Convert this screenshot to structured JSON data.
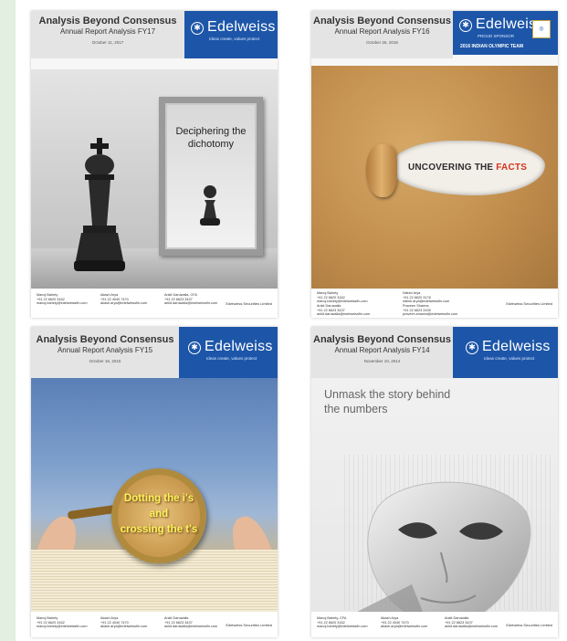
{
  "covers": [
    {
      "title": "Analysis Beyond Consensus",
      "subtitle": "Annual Report Analysis FY17",
      "date": "October 11, 2017",
      "brand": "Edelweiss",
      "tagline": "Ideas create, values protect",
      "headline": "Deciphering the dichotomy",
      "footer": [
        [
          "Manoj Bahety",
          "+91 22 6620 3162",
          "manoj.bahety@edelweissfin.com"
        ],
        [
          "Akash Arya",
          "+91 22 4040 7470",
          "akash.arya@edelweissfin.com"
        ],
        [
          "Ankit Daruwalla, CFA",
          "+91 22 6623 3437",
          "ankit.daruwalla@edelweissfin.com"
        ]
      ],
      "footer_right": "Edelweiss Securities Limited"
    },
    {
      "title": "Analysis Beyond Consensus",
      "subtitle": "Annual Report Analysis FY16",
      "date": "October 26, 2016",
      "brand": "Edelweiss",
      "tagline": "PROUD SPONSOR",
      "sponsor": "2016 INDIAN OLYMPIC TEAM",
      "headline_a": "UNCOVERING THE ",
      "headline_b": "FACTS",
      "footer": [
        [
          "Manoj Bahety",
          "+91 22 6620 3162",
          "manoj.bahety@edelweissfin.com"
        ],
        [
          "Nitesh Arya",
          "+91 22 6620 3178",
          "nitesh.arya@edelweissfin.com"
        ],
        [
          "Ankit Daruwalla",
          "+91 22 6623 3437",
          "ankit.daruwalla@edelweissfin.com"
        ],
        [
          "Praveen Sharma",
          "+91 22 6623 3155",
          "praveen.sharma@edelweissfin.com"
        ]
      ],
      "footer_right": "Edelweiss Securities Limited"
    },
    {
      "title": "Analysis Beyond Consensus",
      "subtitle": "Annual Report Analysis FY15",
      "date": "October 16, 2015",
      "brand": "Edelweiss",
      "tagline": "Ideas create, values protect",
      "headline_lines": [
        "Dotting the i's",
        "and",
        "crossing the t's"
      ],
      "footer": [
        [
          "Manoj Bahety",
          "+91 22 6620 3162",
          "manoj.bahety@edelweissfin.com"
        ],
        [
          "Akash Arya",
          "+91 22 4040 7470",
          "akash.arya@edelweissfin.com"
        ],
        [
          "Ankit Daruwalla",
          "+91 22 6623 3437",
          "ankit.daruwalla@edelweissfin.com"
        ]
      ],
      "footer_right": "Edelweiss Securities Limited"
    },
    {
      "title": "Analysis Beyond Consensus",
      "subtitle": "Annual Report Analysis FY14",
      "date": "November 10, 2014",
      "brand": "Edelweiss",
      "tagline": "Ideas create, values protect",
      "headline_lines": [
        "Unmask the story behind",
        "the numbers"
      ],
      "footer": [
        [
          "Manoj Bahety, CFA",
          "+91 22 6620 3162",
          "manoj.bahety@edelweissfin.com"
        ],
        [
          "Akash Arya",
          "+91 22 4040 7470",
          "akash.arya@edelweissfin.com"
        ],
        [
          "Ankit Daruwalla",
          "+91 22 6623 3437",
          "ankit.daruwalla@edelweissfin.com"
        ]
      ],
      "footer_right": "Edelweiss Securities Limited"
    }
  ],
  "colors": {
    "brand_blue": "#1d56a8",
    "header_gray": "#e4e4e4",
    "facts_red": "#d6341f",
    "lens_text": "#fff35a",
    "left_strip": "#e3efe1"
  }
}
